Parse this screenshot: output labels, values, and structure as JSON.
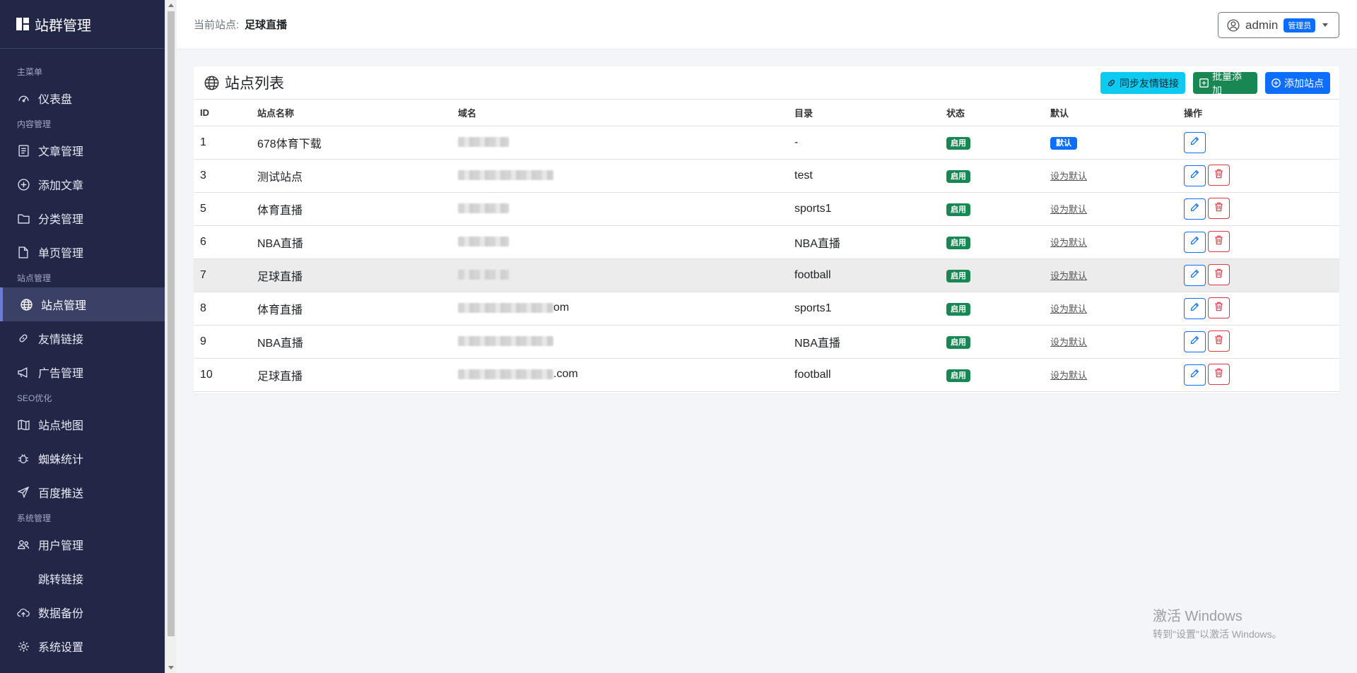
{
  "sidebar": {
    "brand": "站群管理",
    "sections": {
      "main": "主菜单",
      "content": "内容管理",
      "site": "站点管理",
      "seo": "SEO优化",
      "system": "系统管理"
    },
    "items": {
      "dashboard": "仪表盘",
      "articles": "文章管理",
      "add_article": "添加文章",
      "categories": "分类管理",
      "pages": "单页管理",
      "sites": "站点管理",
      "links": "友情链接",
      "ads": "广告管理",
      "sitemap": "站点地图",
      "spider": "蜘蛛统计",
      "baidu": "百度推送",
      "users": "用户管理",
      "redirect": "跳转链接",
      "backup": "数据备份",
      "settings": "系统设置"
    }
  },
  "header": {
    "current_label": "当前站点:",
    "current_site": "足球直播",
    "user": "admin",
    "role": "管理员"
  },
  "card": {
    "title": "站点列表",
    "buttons": {
      "sync": "同步友情链接",
      "batch": "批量添加",
      "add": "添加站点"
    }
  },
  "table": {
    "columns": [
      "ID",
      "站点名称",
      "域名",
      "目录",
      "状态",
      "默认",
      "操作"
    ],
    "rows": [
      {
        "id": "1",
        "name": "678体育下载",
        "domain_suffix": "",
        "dir": "-",
        "status": "启用",
        "default": "默认",
        "is_default": true
      },
      {
        "id": "3",
        "name": "测试站点",
        "domain_suffix": "",
        "dir": "test",
        "status": "启用",
        "default": "设为默认",
        "is_default": false
      },
      {
        "id": "5",
        "name": "体育直播",
        "domain_suffix": "",
        "dir": "sports1",
        "status": "启用",
        "default": "设为默认",
        "is_default": false
      },
      {
        "id": "6",
        "name": "NBA直播",
        "domain_suffix": "",
        "dir": "NBA直播",
        "status": "启用",
        "default": "设为默认",
        "is_default": false
      },
      {
        "id": "7",
        "name": "足球直播",
        "domain_suffix": "",
        "dir": "football",
        "status": "启用",
        "default": "设为默认",
        "is_default": false
      },
      {
        "id": "8",
        "name": "体育直播",
        "domain_suffix": "om",
        "dir": "sports1",
        "status": "启用",
        "default": "设为默认",
        "is_default": false
      },
      {
        "id": "9",
        "name": "NBA直播",
        "domain_suffix": "",
        "dir": "NBA直播",
        "status": "启用",
        "default": "设为默认",
        "is_default": false
      },
      {
        "id": "10",
        "name": "足球直播",
        "domain_suffix": ".com",
        "dir": "football",
        "status": "启用",
        "default": "设为默认",
        "is_default": false
      }
    ]
  },
  "watermark": {
    "line1": "激活 Windows",
    "line2": "转到\"设置\"以激活 Windows。"
  },
  "colors": {
    "sidebar_bg": "#222748",
    "primary": "#0d6efd",
    "success": "#198754",
    "info": "#0dcaf0",
    "danger": "#dc3545"
  }
}
